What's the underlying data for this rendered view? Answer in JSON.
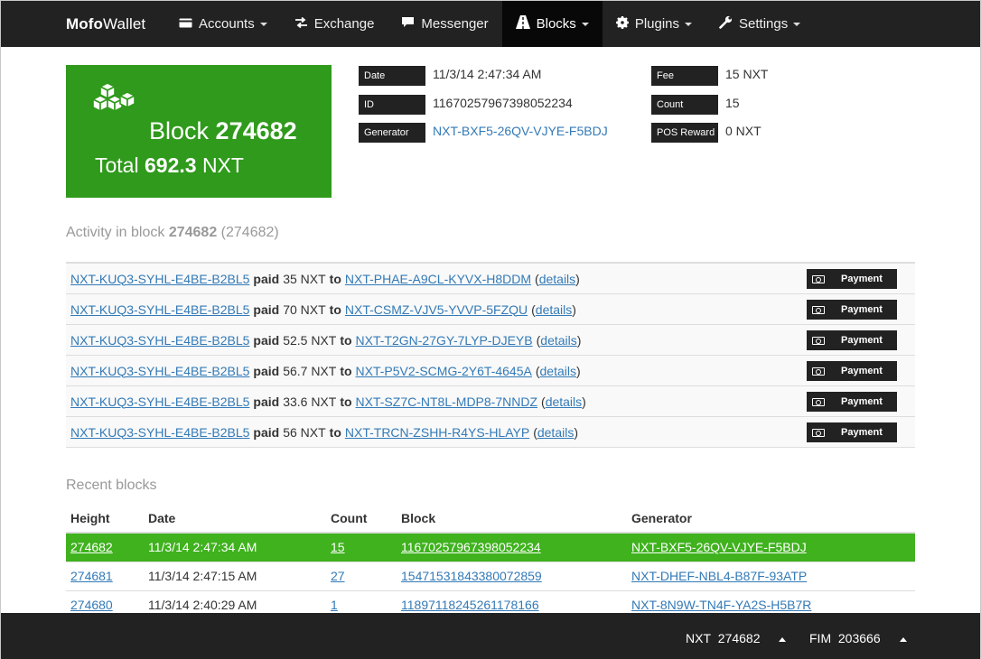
{
  "nav": {
    "brand_bold": "Mofo",
    "brand_rest": "Wallet",
    "items": [
      {
        "label": "Accounts",
        "icon": "credit-card-icon",
        "dropdown": true
      },
      {
        "label": "Exchange",
        "icon": "transfer-icon",
        "dropdown": false
      },
      {
        "label": "Messenger",
        "icon": "comment-icon",
        "dropdown": false
      },
      {
        "label": "Blocks",
        "icon": "road-icon",
        "dropdown": true,
        "active": true
      },
      {
        "label": "Plugins",
        "icon": "gear-icon",
        "dropdown": true
      },
      {
        "label": "Settings",
        "icon": "wrench-icon",
        "dropdown": true
      }
    ]
  },
  "block": {
    "label": "Block",
    "height": "274682",
    "total_label": "Total",
    "total_value": "692.3",
    "total_unit": "NXT",
    "color": "#2f9a1b"
  },
  "details": {
    "date_label": "Date",
    "date": "11/3/14 2:47:34 AM",
    "id_label": "ID",
    "id": "11670257967398052234",
    "generator_label": "Generator",
    "generator": "NXT-BXF5-26QV-VJYE-F5BDJ",
    "fee_label": "Fee",
    "fee": "15 NXT",
    "count_label": "Count",
    "count": "15",
    "pos_label": "POS Reward",
    "pos": "0 NXT"
  },
  "activity": {
    "title_prefix": "Activity in block",
    "title_block": "274682",
    "title_suffix": "(274682)",
    "rows": [
      {
        "sender": "NXT-KUQ3-SYHL-E4BE-B2BL5",
        "verb": "paid",
        "amount": "35 NXT",
        "to": "to",
        "recipient": "NXT-PHAE-A9CL-KYVX-H8DDM",
        "details": "details",
        "type": "Payment"
      },
      {
        "sender": "NXT-KUQ3-SYHL-E4BE-B2BL5",
        "verb": "paid",
        "amount": "70 NXT",
        "to": "to",
        "recipient": "NXT-CSMZ-VJV5-YVVP-5FZQU",
        "details": "details",
        "type": "Payment"
      },
      {
        "sender": "NXT-KUQ3-SYHL-E4BE-B2BL5",
        "verb": "paid",
        "amount": "52.5 NXT",
        "to": "to",
        "recipient": "NXT-T2GN-27GY-7LYP-DJEYB",
        "details": "details",
        "type": "Payment"
      },
      {
        "sender": "NXT-KUQ3-SYHL-E4BE-B2BL5",
        "verb": "paid",
        "amount": "56.7 NXT",
        "to": "to",
        "recipient": "NXT-P5V2-SCMG-2Y6T-4645A",
        "details": "details",
        "type": "Payment"
      },
      {
        "sender": "NXT-KUQ3-SYHL-E4BE-B2BL5",
        "verb": "paid",
        "amount": "33.6 NXT",
        "to": "to",
        "recipient": "NXT-SZ7C-NT8L-MDP8-7NNDZ",
        "details": "details",
        "type": "Payment"
      },
      {
        "sender": "NXT-KUQ3-SYHL-E4BE-B2BL5",
        "verb": "paid",
        "amount": "56 NXT",
        "to": "to",
        "recipient": "NXT-TRCN-ZSHH-R4YS-HLAYP",
        "details": "details",
        "type": "Payment"
      }
    ]
  },
  "recent": {
    "title": "Recent blocks",
    "headers": [
      "Height",
      "Date",
      "Count",
      "Block",
      "Generator"
    ],
    "rows": [
      {
        "height": "274682",
        "date": "11/3/14 2:47:34 AM",
        "count": "15",
        "block": "11670257967398052234",
        "generator": "NXT-BXF5-26QV-VJYE-F5BDJ",
        "active": true
      },
      {
        "height": "274681",
        "date": "11/3/14 2:47:15 AM",
        "count": "27",
        "block": "1547153184338007285​9",
        "generator": "NXT-DHEF-NBL4-B87F-93ATP",
        "active": false
      },
      {
        "height": "274680",
        "date": "11/3/14 2:40:29 AM",
        "count": "1",
        "block": "11897118245261178166",
        "generator": "NXT-8N9W-TN4F-YA2S-H5B7R",
        "active": false
      }
    ],
    "active_color": "#3fb21e"
  },
  "footer": {
    "nxt_label": "NXT",
    "nxt_height": "274682",
    "fim_label": "FIM",
    "fim_height": "203666"
  }
}
